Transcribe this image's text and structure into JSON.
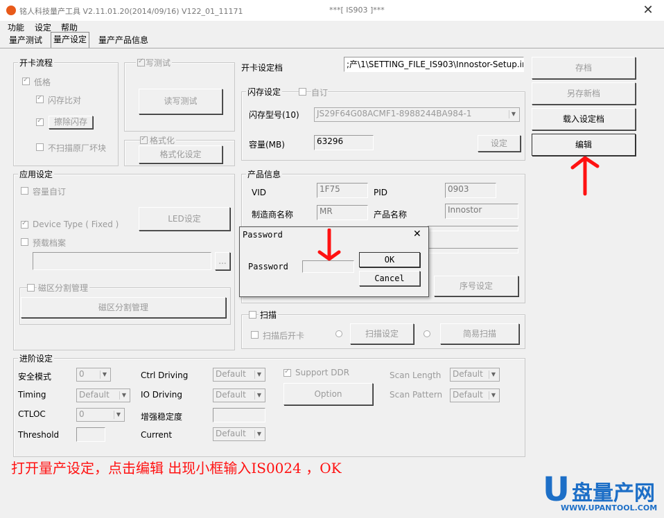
{
  "window": {
    "title": "铭人科技量产工具 V2.11.01.20(2014/09/16)   V122_01_11171",
    "title2": "***[  IS903 ]***",
    "close_glyph": "✕"
  },
  "menu": {
    "items": [
      "功能",
      "设定",
      "帮助"
    ]
  },
  "tabs": [
    "量产测试",
    "量产设定",
    "量产产品信息"
  ],
  "setting_file": {
    "label": "开卡设定档",
    "value": ";产\\1\\SETTING_FILE_IS903\\Innostor-Setup.ini"
  },
  "right_buttons": {
    "save": "存档",
    "save_as": "另存新档",
    "load": "载入设定档",
    "edit": "编辑"
  },
  "card_flow": {
    "title": "开卡流程",
    "low_format": "低格",
    "flash_compare": "闪存比对",
    "erase_flash": "擦除闪存",
    "no_scan_bad": "不扫描原厂坏块"
  },
  "rw_test": {
    "title": "读写测试",
    "button": "读写测试"
  },
  "format": {
    "title": "格式化",
    "button": "格式化设定"
  },
  "flash": {
    "title": "闪存设定",
    "custom": "自订",
    "model_label": "闪存型号(10)",
    "model_value": "JS29F64G08ACMF1-8988244BA984-1",
    "capacity_label": "容量(MB)",
    "capacity_value": "63296",
    "set_button": "设定"
  },
  "app": {
    "title": "应用设定",
    "capacity_custom": "容量自订",
    "device_type": "Device Type ( Fixed )",
    "led_button": "LED设定",
    "preload": "预载档案",
    "browse": "...",
    "partition_title": "磁区分割管理",
    "partition_button": "磁区分割管理"
  },
  "product": {
    "title": "产品信息",
    "vid_label": "VID",
    "vid": "1F75",
    "pid_label": "PID",
    "pid": "0903",
    "vendor_label": "制造商名称",
    "vendor": "MR",
    "product_label": "产品名称",
    "product": "Innostor",
    "serial_button": "序号设定"
  },
  "scan": {
    "title": "扫描",
    "open_after": "扫描后开卡",
    "scan_setting": "扫描设定",
    "easy_scan": "简易扫描"
  },
  "advanced": {
    "title": "进阶设定",
    "safe_mode": "安全模式",
    "safe_mode_val": "0",
    "timing": "Timing",
    "timing_val": "Default",
    "ctloc": "CTLOC",
    "ctloc_val": "0",
    "threshold": "Threshold",
    "ctrl_driving": "Ctrl Driving",
    "ctrl_driving_val": "Default",
    "io_driving": "IO Driving",
    "io_driving_val": "Default",
    "stability": "增强稳定度",
    "current": "Current",
    "current_val": "Default",
    "support_ddr": "Support DDR",
    "option": "Option",
    "scan_length": "Scan Length",
    "scan_length_val": "Default",
    "scan_pattern": "Scan Pattern",
    "scan_pattern_val": "Default"
  },
  "dialog": {
    "title": "Password",
    "label": "Password",
    "ok": "OK",
    "cancel": "Cancel",
    "close_glyph": "✕"
  },
  "caption": "打开量产设定，点击编辑 出现小框输入IS0024 ，OK",
  "logo": {
    "text": "盘量产网",
    "url": "WWW.UPANTOOL.COM",
    "letter": "U"
  },
  "colors": {
    "annotation": "#ff1111",
    "logo_blue": "#1d6fc7"
  }
}
